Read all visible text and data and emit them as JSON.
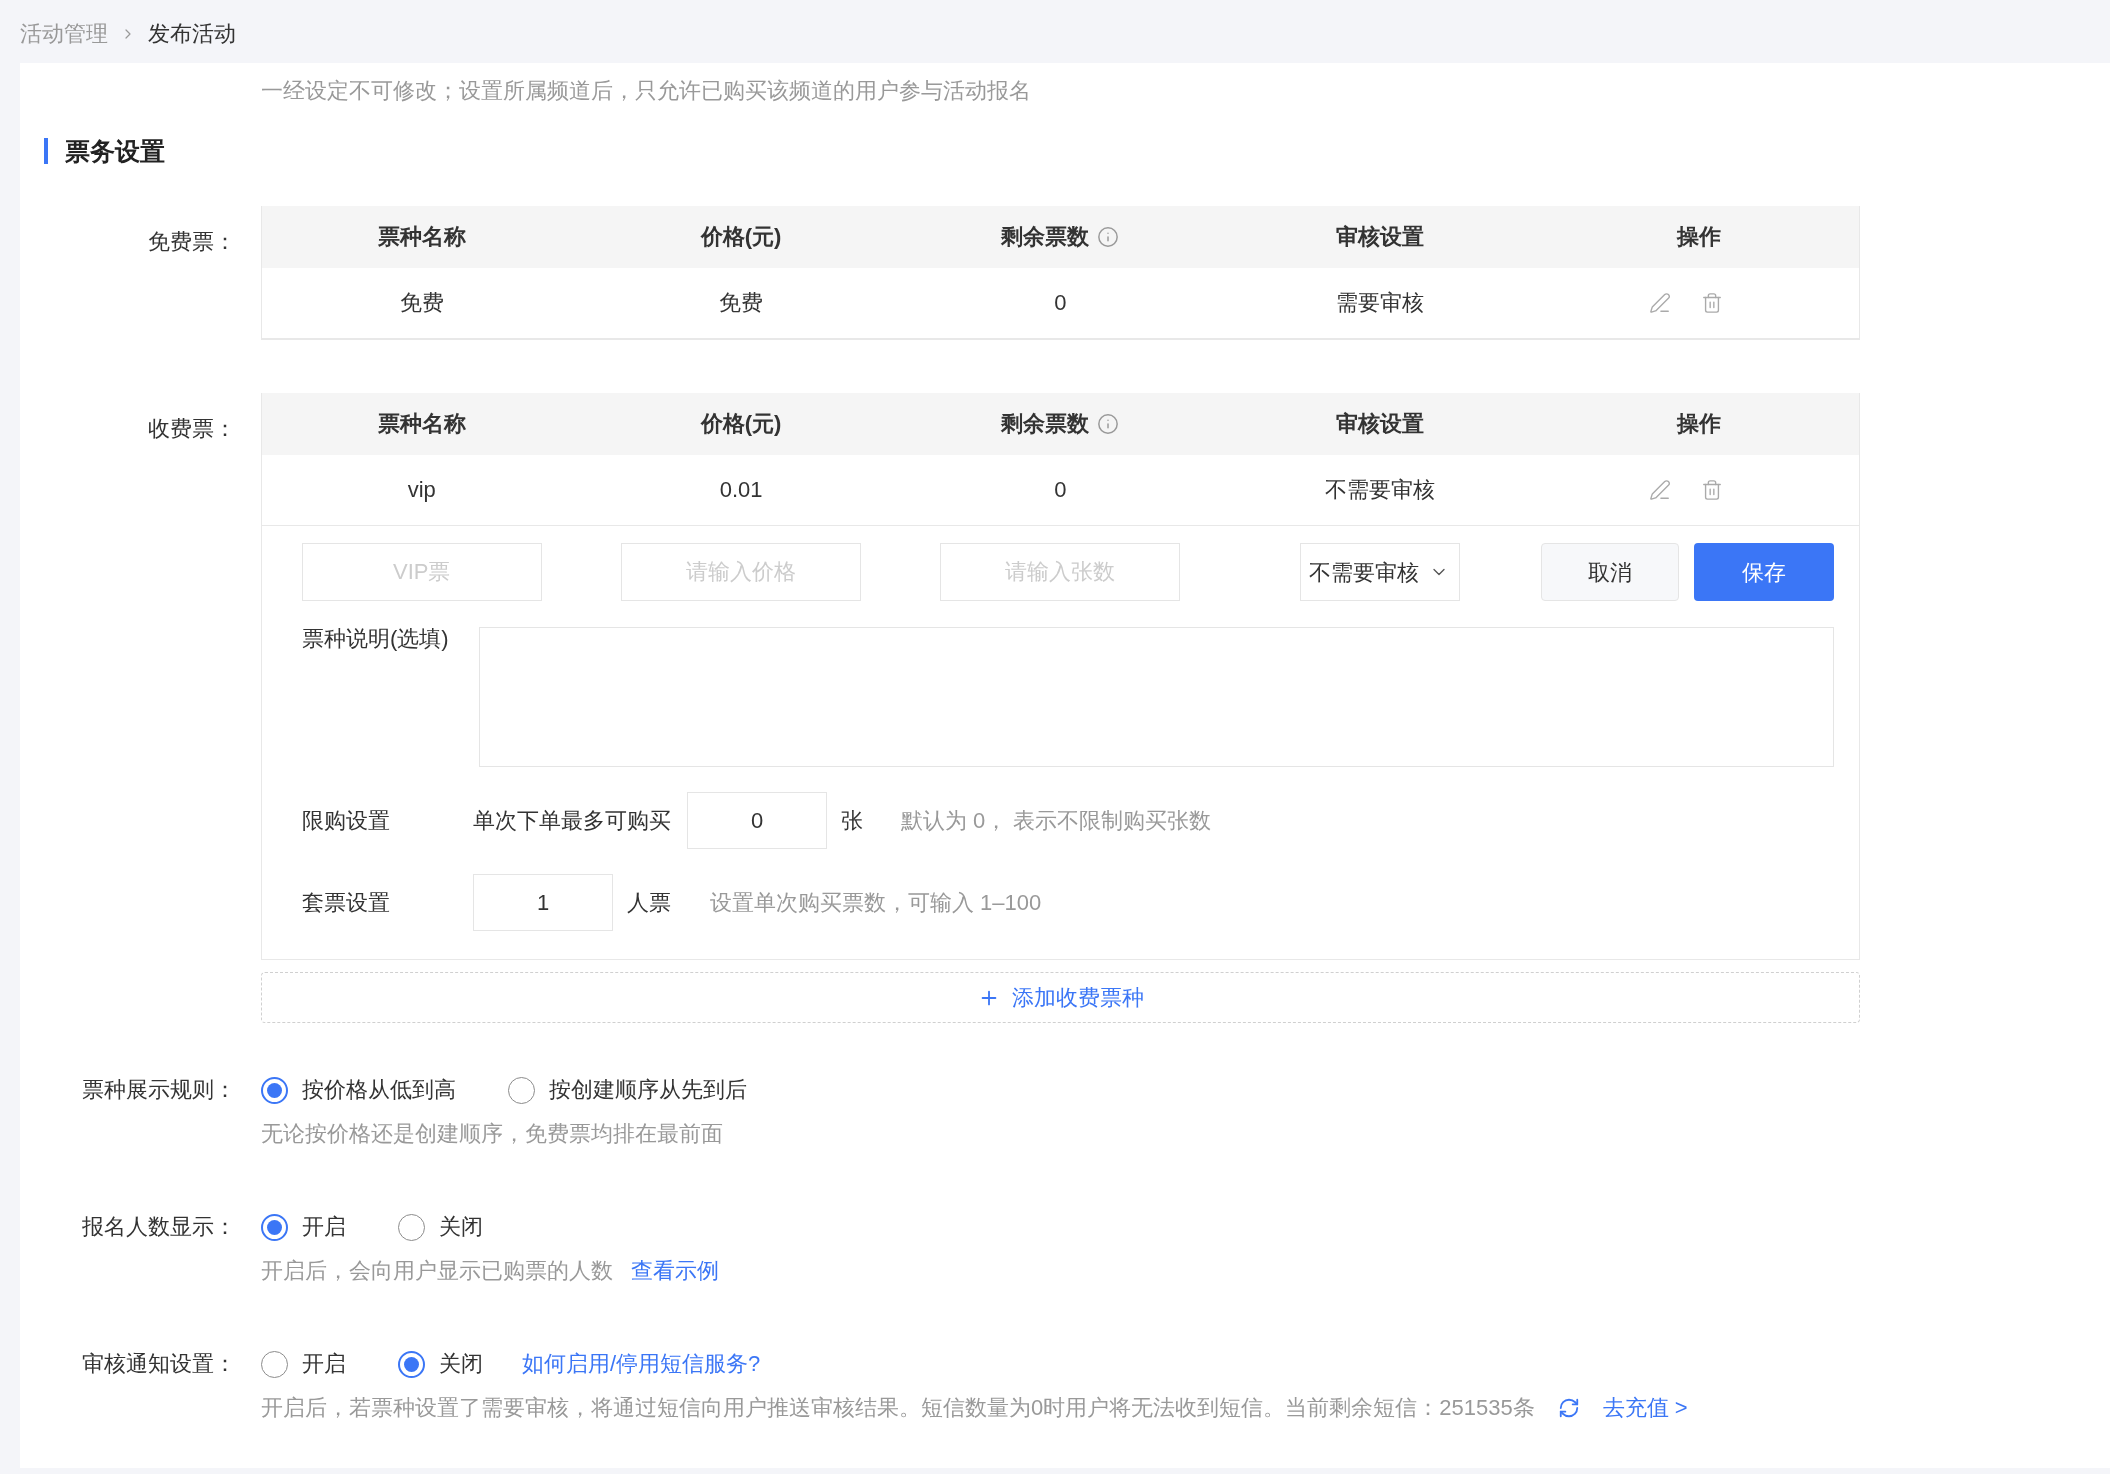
{
  "breadcrumb": [
    {
      "label": "活动管理",
      "current": false
    },
    {
      "label": "发布活动",
      "current": true
    }
  ],
  "channel_hint": "一经设定不可修改；设置所属频道后，只允许已购买该频道的用户参与活动报名",
  "section_title": "票务设置",
  "free_tickets": {
    "label": "免费票：",
    "columns": [
      {
        "title": "票种名称",
        "has_info": false
      },
      {
        "title": "价格(元)",
        "has_info": false
      },
      {
        "title": "剩余票数",
        "has_info": true
      },
      {
        "title": "审核设置",
        "has_info": false
      },
      {
        "title": "操作",
        "has_info": false
      }
    ],
    "rows": [
      {
        "name": "免费",
        "price": "免费",
        "remaining": "0",
        "review": "需要审核"
      }
    ]
  },
  "paid_tickets": {
    "label": "收费票：",
    "columns": [
      {
        "title": "票种名称",
        "has_info": false
      },
      {
        "title": "价格(元)",
        "has_info": false
      },
      {
        "title": "剩余票数",
        "has_info": true
      },
      {
        "title": "审核设置",
        "has_info": false
      },
      {
        "title": "操作",
        "has_info": false
      }
    ],
    "rows": [
      {
        "name": "vip",
        "price": "0.01",
        "remaining": "0",
        "review": "不需要审核"
      }
    ],
    "editor": {
      "name_field": {
        "placeholder": "VIP票"
      },
      "price_field": {
        "placeholder": "请输入价格"
      },
      "count_field": {
        "placeholder": "请输入张数"
      },
      "review_select": {
        "value": "不需要审核"
      },
      "cancel": "取消",
      "save": "保存",
      "description": {
        "label": "票种说明(选填)"
      },
      "limit": {
        "label": "限购设置",
        "prefix": "单次下单最多可购买",
        "value": "0",
        "unit": "张",
        "hint": "默认为 0， 表示不限制购买张数"
      },
      "bundle": {
        "label": "套票设置",
        "value": "1",
        "unit": "人票",
        "hint": "设置单次购买票数，可输入 1–100"
      }
    }
  },
  "add_button": "添加收费票种",
  "settings": [
    {
      "label": "票种展示规则：",
      "options": [
        {
          "label": "按价格从低到高",
          "selected": true
        },
        {
          "label": "按创建顺序从先到后",
          "selected": false
        }
      ],
      "hint": "无论按价格还是创建顺序，免费票均排在最前面"
    },
    {
      "label": "报名人数显示：",
      "options": [
        {
          "label": "开启",
          "selected": true
        },
        {
          "label": "关闭",
          "selected": false
        }
      ],
      "hint": "开启后，会向用户显示已购票的人数",
      "hint_link": "查看示例"
    },
    {
      "label": "审核通知设置：",
      "options": [
        {
          "label": "开启",
          "selected": false
        },
        {
          "label": "关闭",
          "selected": true
        }
      ],
      "help_link": "如何启用/停用短信服务?",
      "hint": "开启后，若票种设置了需要审核，将通过短信向用户推送审核结果。短信数量为0时用户将无法收到短信。当前剩余短信：251535条",
      "recharge_link": "去充值 >"
    }
  ]
}
